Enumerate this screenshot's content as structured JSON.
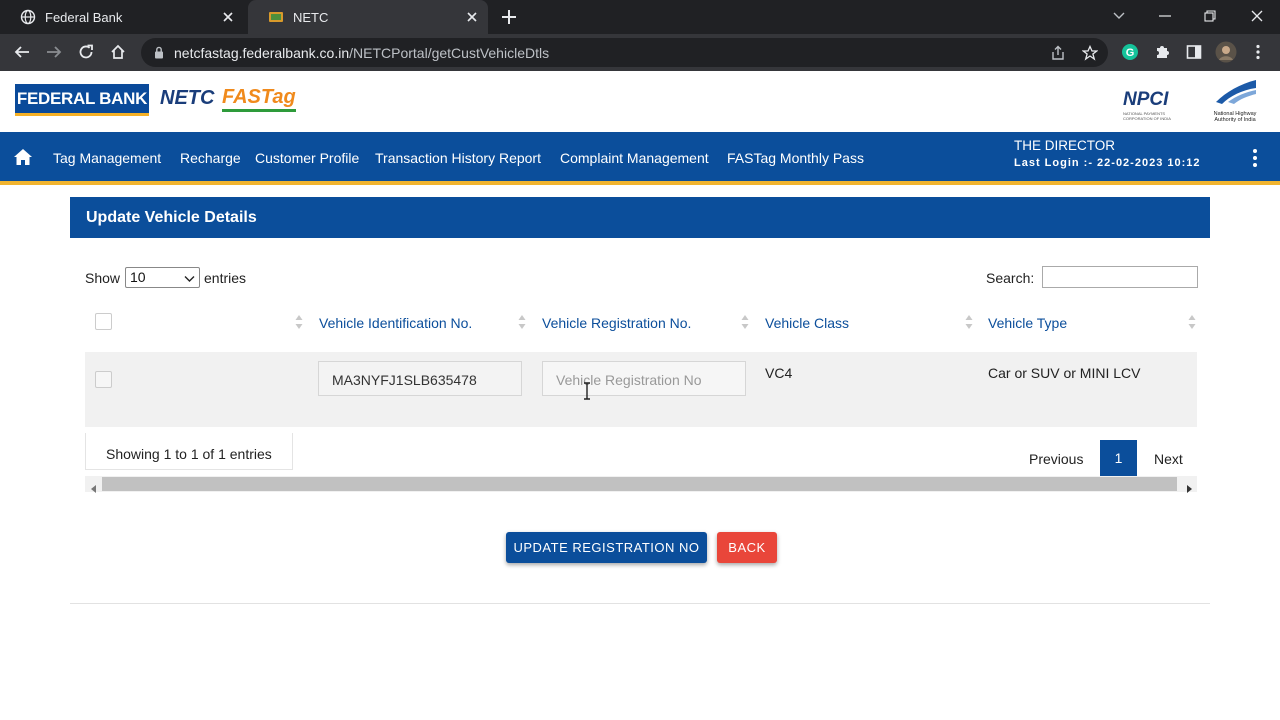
{
  "browser": {
    "tabs": [
      {
        "title": "Federal Bank",
        "active": false
      },
      {
        "title": "NETC",
        "active": true
      }
    ],
    "url_host": "netcfastag.federalbank.co.in",
    "url_path": "/NETCPortal/getCustVehicleDtls"
  },
  "header": {
    "bank_logo": "FEDERAL BANK",
    "netc_logo": "NETC",
    "fastag_logo": "FASTag",
    "npci_logo": "NPCI",
    "npci_tagline": "NATIONAL PAYMENTS CORPORATION OF INDIA",
    "nhai_caption": "National Highway Authority of India"
  },
  "nav": {
    "items": [
      "Tag Management",
      "Recharge",
      "Customer Profile",
      "Transaction History Report",
      "Complaint Management",
      "FASTag Monthly Pass"
    ],
    "user": "THE DIRECTOR",
    "last_login": "Last Login :- 22-02-2023 10:12"
  },
  "panel": {
    "title": "Update Vehicle Details"
  },
  "table": {
    "length_prefix": "Show",
    "length_value": "10",
    "length_suffix": "entries",
    "search_label": "Search:",
    "columns": [
      "Vehicle Identification No.",
      "Vehicle Registration No.",
      "Vehicle Class",
      "Vehicle Type"
    ],
    "rows": [
      {
        "vin": "MA3NYFJ1SLB635478",
        "reg_placeholder": "Vehicle Registration No",
        "class": "VC4",
        "type": "Car or SUV or MINI LCV"
      }
    ],
    "info": "Showing 1 to 1 of 1 entries",
    "pagination": {
      "previous": "Previous",
      "current": "1",
      "next": "Next"
    }
  },
  "actions": {
    "update": "UPDATE REGISTRATION NO",
    "back": "BACK"
  },
  "colors": {
    "primary": "#0b4e9b",
    "accent": "#f1b42f",
    "danger": "#e9463a"
  }
}
